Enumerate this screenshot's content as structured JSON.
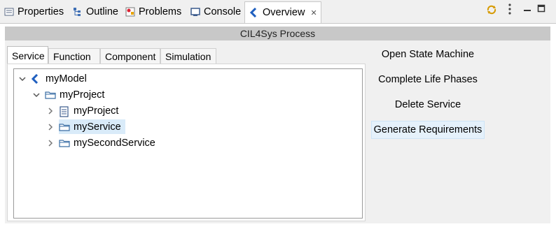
{
  "view_tabs": [
    {
      "label": "Properties",
      "icon": "properties-icon"
    },
    {
      "label": "Outline",
      "icon": "outline-icon"
    },
    {
      "label": "Problems",
      "icon": "problems-icon"
    },
    {
      "label": "Console",
      "icon": "console-icon"
    },
    {
      "label": "Overview",
      "icon": "overview-icon",
      "active": true,
      "closable": true
    }
  ],
  "toolbar": {
    "sync_icon": "sync-icon",
    "menu_icon": "view-menu-icon",
    "minimize_icon": "minimize-icon",
    "maximize_icon": "maximize-icon"
  },
  "process": {
    "title": "CIL4Sys Process"
  },
  "inner_tabs": [
    {
      "label": "Service",
      "active": true
    },
    {
      "label": "Function"
    },
    {
      "label": "Component"
    },
    {
      "label": "Simulation"
    }
  ],
  "tree": [
    {
      "label": "myModel",
      "icon": "model-icon",
      "expanded": true
    },
    {
      "label": "myProject",
      "icon": "folder-icon",
      "expanded": true
    },
    {
      "label": "myProject",
      "icon": "document-icon",
      "expanded": false
    },
    {
      "label": "myService",
      "icon": "folder-icon",
      "expanded": false,
      "selected": true
    },
    {
      "label": "mySecondService",
      "icon": "folder-icon",
      "expanded": false
    }
  ],
  "actions": [
    {
      "label": "Open State Machine"
    },
    {
      "label": "Complete Life Phases"
    },
    {
      "label": "Delete Service"
    },
    {
      "label": "Generate Requirements",
      "hovered": true
    }
  ],
  "colors": {
    "accent": "#1f5fbf",
    "selection": "#d9ebf9",
    "title_bar": "#c8c8c8"
  }
}
